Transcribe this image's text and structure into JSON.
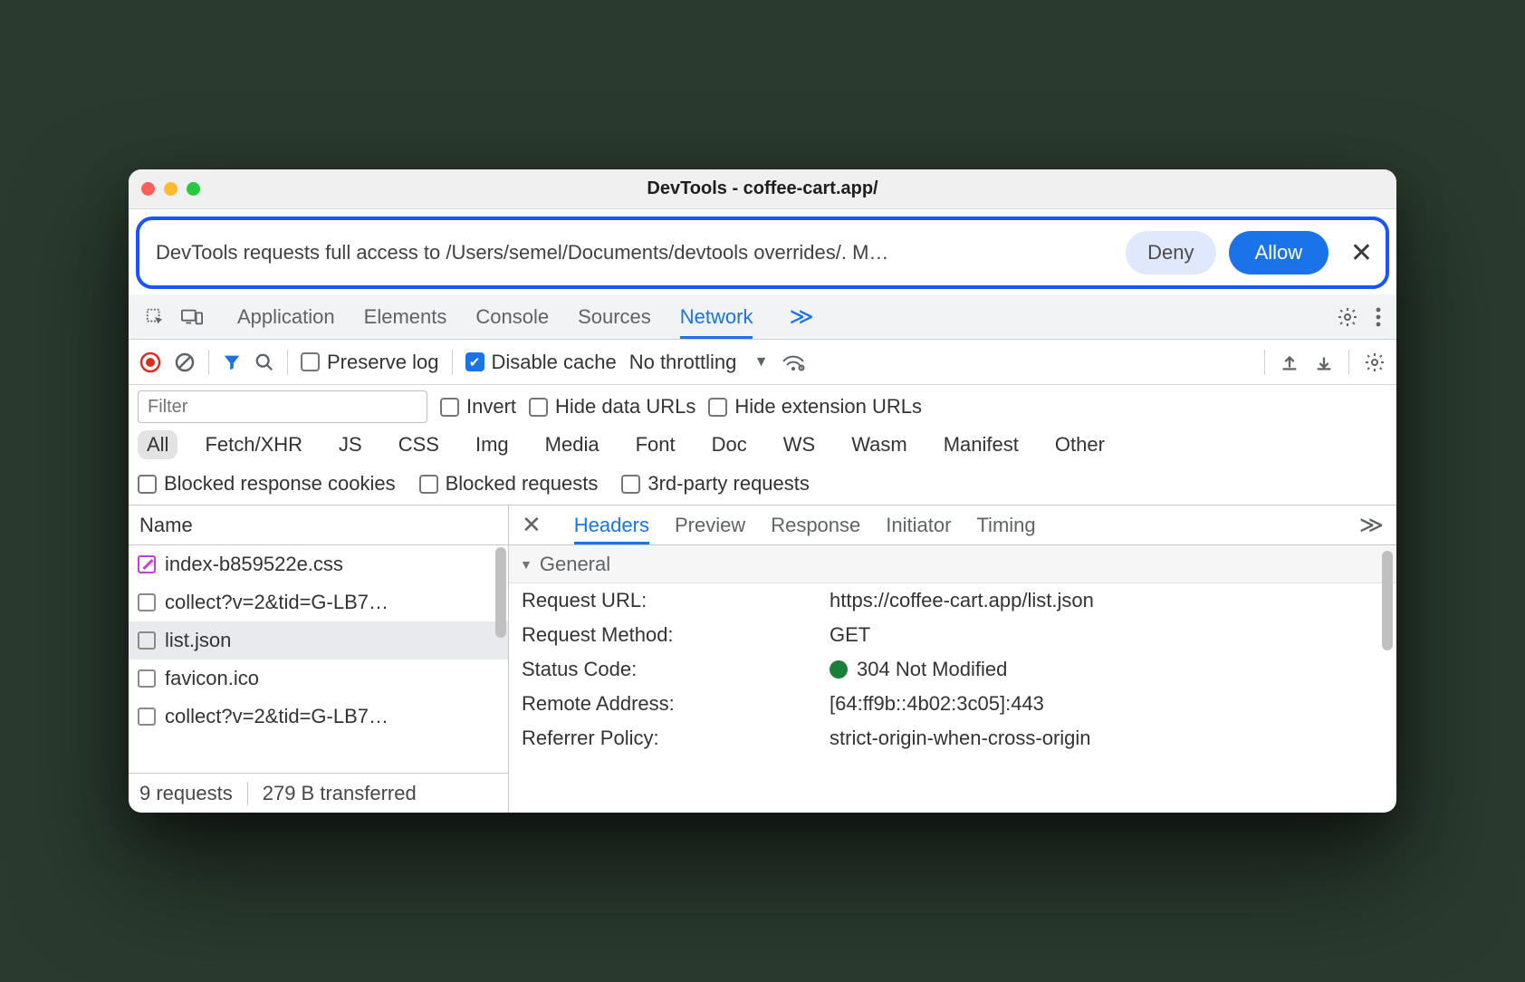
{
  "window": {
    "title": "DevTools - coffee-cart.app/"
  },
  "permission": {
    "message": "DevTools requests full access to /Users/semel/Documents/devtools overrides/. M…",
    "deny": "Deny",
    "allow": "Allow"
  },
  "panel_tabs": [
    "Application",
    "Elements",
    "Console",
    "Sources",
    "Network"
  ],
  "active_panel": "Network",
  "toolbar": {
    "preserve_log": "Preserve log",
    "disable_cache": "Disable cache",
    "throttling": "No throttling"
  },
  "filter": {
    "placeholder": "Filter",
    "invert": "Invert",
    "hide_data_urls": "Hide data URLs",
    "hide_ext_urls": "Hide extension URLs"
  },
  "types": [
    "All",
    "Fetch/XHR",
    "JS",
    "CSS",
    "Img",
    "Media",
    "Font",
    "Doc",
    "WS",
    "Wasm",
    "Manifest",
    "Other"
  ],
  "extra_checks": {
    "blocked_cookies": "Blocked response cookies",
    "blocked_requests": "Blocked requests",
    "third_party": "3rd-party requests"
  },
  "name_header": "Name",
  "requests": [
    {
      "name": "index-b859522e.css",
      "override": true
    },
    {
      "name": "collect?v=2&tid=G-LB7…",
      "override": false
    },
    {
      "name": "list.json",
      "override": false,
      "selected": true
    },
    {
      "name": "favicon.ico",
      "override": false
    },
    {
      "name": "collect?v=2&tid=G-LB7…",
      "override": false
    }
  ],
  "footer": {
    "requests": "9 requests",
    "transferred": "279 B transferred"
  },
  "detail_tabs": [
    "Headers",
    "Preview",
    "Response",
    "Initiator",
    "Timing"
  ],
  "active_detail": "Headers",
  "general_label": "General",
  "general": {
    "request_url_k": "Request URL:",
    "request_url_v": "https://coffee-cart.app/list.json",
    "method_k": "Request Method:",
    "method_v": "GET",
    "status_k": "Status Code:",
    "status_v": "304 Not Modified",
    "remote_k": "Remote Address:",
    "remote_v": "[64:ff9b::4b02:3c05]:443",
    "referrer_k": "Referrer Policy:",
    "referrer_v": "strict-origin-when-cross-origin"
  }
}
